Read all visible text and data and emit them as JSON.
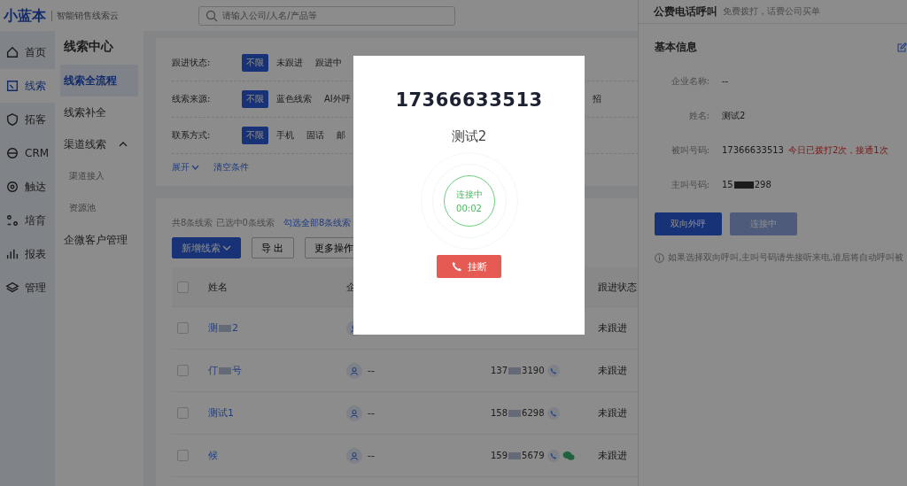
{
  "header": {
    "logo": "小蓝本",
    "tagline": "智能销售线索云",
    "search_placeholder": "请输入公司/人名/产品等"
  },
  "nav": [
    {
      "label": "首页",
      "selected": false
    },
    {
      "label": "线索",
      "selected": true
    },
    {
      "label": "拓客",
      "selected": false
    },
    {
      "label": "CRM",
      "selected": false
    },
    {
      "label": "触达",
      "selected": false
    },
    {
      "label": "培育",
      "selected": false
    },
    {
      "label": "报表",
      "selected": false
    },
    {
      "label": "管理",
      "selected": false
    }
  ],
  "subnav": {
    "title": "线索中心",
    "items": [
      {
        "label": "线索全流程",
        "selected": true
      },
      {
        "label": "线索补全",
        "selected": false
      },
      {
        "label": "渠道线索",
        "selected": false,
        "expanded": true,
        "children": [
          {
            "label": "渠道接入",
            "selected": false
          },
          {
            "label": "资源池",
            "selected": false
          }
        ]
      },
      {
        "label": "企微客户管理",
        "selected": false
      }
    ]
  },
  "filters": [
    {
      "label": "跟进状态:",
      "options": [
        {
          "label": "不限",
          "selected": true
        },
        {
          "label": "未跟进",
          "selected": false
        },
        {
          "label": "跟进中",
          "selected": false
        }
      ]
    },
    {
      "label": "线索来源:",
      "options": [
        {
          "label": "不限",
          "selected": true
        },
        {
          "label": "蓝色线索",
          "selected": false
        },
        {
          "label": "AI外呼",
          "selected": false
        }
      ],
      "trailing": "招"
    },
    {
      "label": "联系方式:",
      "options": [
        {
          "label": "不限",
          "selected": true
        },
        {
          "label": "手机",
          "selected": false
        },
        {
          "label": "固话",
          "selected": false
        },
        {
          "label": "邮",
          "selected": false
        }
      ]
    }
  ],
  "filter_links": [
    "展开",
    "清空条件"
  ],
  "summary": "共8条线索 已选中0条线索",
  "select_all_link": "勾选全部8条线索",
  "toolbar": [
    {
      "label": "新增线索",
      "kind": "primary"
    },
    {
      "label": "导 出",
      "kind": "plain"
    },
    {
      "label": "更多操作",
      "kind": "plain"
    }
  ],
  "table": {
    "all_checked": false,
    "columns": [
      "姓名",
      "企",
      "跟进状态"
    ],
    "rows": [
      {
        "checked": false,
        "name": "测",
        "name_tail": "2",
        "status": "未跟进"
      },
      {
        "checked": false,
        "name": "仃",
        "name_tail": "号",
        "company": "--",
        "phone_head": "137",
        "phone_tail": "3190",
        "wechat": false,
        "status": "未跟进"
      },
      {
        "checked": false,
        "name": "测试1",
        "company": "--",
        "phone_head": "158",
        "phone_tail": "6298",
        "wechat": false,
        "status": "未跟进"
      },
      {
        "checked": false,
        "name": "候",
        "company": "--",
        "phone_head": "159",
        "phone_tail": "5679",
        "wechat": true,
        "status": "未跟进"
      }
    ]
  },
  "drawer": {
    "title": "公费电话呼叫",
    "subtitle": "免费拨打，话费公司买单",
    "section": "基本信息",
    "fields": [
      {
        "label": "企业名称:",
        "value": "--"
      },
      {
        "label": "姓名:",
        "value": "测试2"
      },
      {
        "label": "被叫号码:",
        "value": "17366633513",
        "note": "今日已拨打2次，接通1次"
      },
      {
        "label": "主叫号码:",
        "value": "15",
        "value_tail": "298"
      }
    ],
    "buttons": [
      {
        "label": "双向外呼",
        "disabled": false
      },
      {
        "label": "连接中",
        "disabled": true
      }
    ],
    "hint": "如果选择双向呼叫,主叫号码请先接听来电,谁后将自动呼叫被"
  },
  "call_dialog": {
    "number": "17366633513",
    "name": "测试2",
    "status": "连接中",
    "timer": "00:02",
    "hangup": "挂断"
  }
}
